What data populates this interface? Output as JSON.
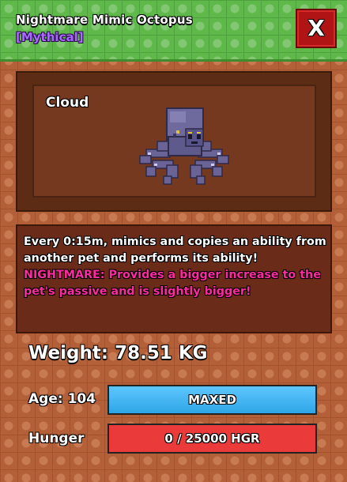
{
  "header": {
    "title": "Nightmare Mimic Octopus",
    "rarity": "[Mythical]",
    "close_label": "X"
  },
  "display": {
    "label": "Cloud"
  },
  "description": {
    "ability_text": "Every 0:15m, mimics and copies an ability from another pet and performs its ability!",
    "mutation_name": "NIGHTMARE:",
    "mutation_text": "Provides a bigger increase to the pet's passive and is slightly bigger!"
  },
  "stats": {
    "weight_label": "Weight: 78.51 KG",
    "age_label": "Age: 104",
    "age_bar_text": "MAXED",
    "age_progress": 1.0,
    "hunger_label": "Hunger",
    "hunger_bar_text": "0 / 25000 HGR",
    "hunger_progress": 0.0
  },
  "colors": {
    "rarity": "#a76bff",
    "mutation": "#ff2aa0",
    "close_button": "#b01414",
    "age_bar": "#2ea6e6",
    "hunger_bar": "#e53333"
  },
  "icons": {
    "close": "close-icon",
    "pet": "octopus-pet-image"
  }
}
